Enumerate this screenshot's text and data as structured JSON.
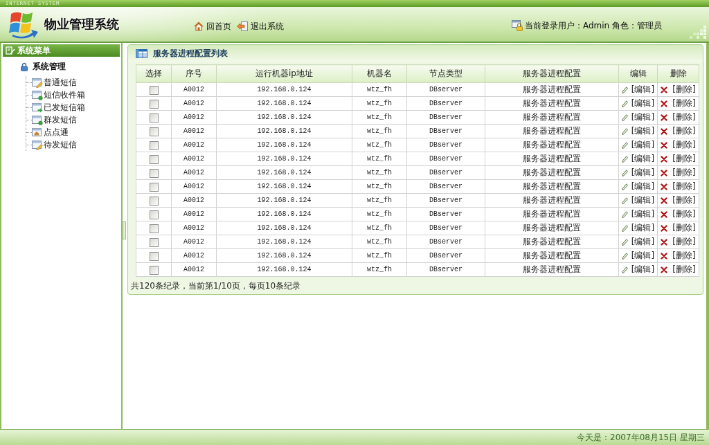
{
  "header": {
    "tagline": "INTERNET SYSTEM",
    "title": "物业管理系统",
    "nav": [
      {
        "label": "回首页",
        "kind": "home"
      },
      {
        "label": "退出系统",
        "kind": "logout"
      }
    ],
    "user_info": "当前登录用户：Admin 角色：管理员"
  },
  "sidebar": {
    "title": "系统菜单",
    "group": {
      "label": "系统管理",
      "children": [
        {
          "label": "普通短信",
          "kind": "compose"
        },
        {
          "label": "短信收件箱",
          "kind": "inbox"
        },
        {
          "label": "已发短信箱",
          "kind": "sent"
        },
        {
          "label": "群发短信",
          "kind": "broadcast"
        },
        {
          "label": "点点通",
          "kind": "web"
        },
        {
          "label": "待发短信",
          "kind": "draft"
        }
      ]
    }
  },
  "panel": {
    "title": "服务器进程配置列表",
    "table": {
      "columns": [
        "选择",
        "序号",
        "运行机器ip地址",
        "机器名",
        "节点类型",
        "服务器进程配置",
        "编辑",
        "删除"
      ],
      "rows": [
        {
          "checked": false,
          "id": "A0012",
          "ip": "192.168.0.124",
          "host": "wtz_fh",
          "node_type": "DBserver",
          "config": "服务器进程配置",
          "edit": "[编辑]",
          "delete": "[删除]"
        },
        {
          "checked": false,
          "id": "A0012",
          "ip": "192.168.0.124",
          "host": "wtz_fh",
          "node_type": "DBserver",
          "config": "服务器进程配置",
          "edit": "[编辑]",
          "delete": "[删除]"
        },
        {
          "checked": false,
          "id": "A0012",
          "ip": "192.168.0.124",
          "host": "wtz_fh",
          "node_type": "DBserver",
          "config": "服务器进程配置",
          "edit": "[编辑]",
          "delete": "[删除]"
        },
        {
          "checked": false,
          "id": "A0012",
          "ip": "192.168.0.124",
          "host": "wtz_fh",
          "node_type": "DBserver",
          "config": "服务器进程配置",
          "edit": "[编辑]",
          "delete": "[删除]"
        },
        {
          "checked": false,
          "id": "A0012",
          "ip": "192.168.0.124",
          "host": "wtz_fh",
          "node_type": "DBserver",
          "config": "服务器进程配置",
          "edit": "[编辑]",
          "delete": "[删除]"
        },
        {
          "checked": false,
          "id": "A0012",
          "ip": "192.168.0.124",
          "host": "wtz_fh",
          "node_type": "DBserver",
          "config": "服务器进程配置",
          "edit": "[编辑]",
          "delete": "[删除]"
        },
        {
          "checked": false,
          "id": "A0012",
          "ip": "192.168.0.124",
          "host": "wtz_fh",
          "node_type": "DBserver",
          "config": "服务器进程配置",
          "edit": "[编辑]",
          "delete": "[删除]"
        },
        {
          "checked": false,
          "id": "A0012",
          "ip": "192.168.0.124",
          "host": "wtz_fh",
          "node_type": "DBserver",
          "config": "服务器进程配置",
          "edit": "[编辑]",
          "delete": "[删除]"
        },
        {
          "checked": false,
          "id": "A0012",
          "ip": "192.168.0.124",
          "host": "wtz_fh",
          "node_type": "DBserver",
          "config": "服务器进程配置",
          "edit": "[编辑]",
          "delete": "[删除]"
        },
        {
          "checked": false,
          "id": "A0012",
          "ip": "192.168.0.124",
          "host": "wtz_fh",
          "node_type": "DBserver",
          "config": "服务器进程配置",
          "edit": "[编辑]",
          "delete": "[删除]"
        },
        {
          "checked": false,
          "id": "A0012",
          "ip": "192.168.0.124",
          "host": "wtz_fh",
          "node_type": "DBserver",
          "config": "服务器进程配置",
          "edit": "[编辑]",
          "delete": "[删除]"
        },
        {
          "checked": false,
          "id": "A0012",
          "ip": "192.168.0.124",
          "host": "wtz_fh",
          "node_type": "DBserver",
          "config": "服务器进程配置",
          "edit": "[编辑]",
          "delete": "[删除]"
        },
        {
          "checked": false,
          "id": "A0012",
          "ip": "192.168.0.124",
          "host": "wtz_fh",
          "node_type": "DBserver",
          "config": "服务器进程配置",
          "edit": "[编辑]",
          "delete": "[删除]"
        },
        {
          "checked": false,
          "id": "A0012",
          "ip": "192.168.0.124",
          "host": "wtz_fh",
          "node_type": "DBserver",
          "config": "服务器进程配置",
          "edit": "[编辑]",
          "delete": "[删除]"
        }
      ]
    },
    "pagination": "共120条纪录，当前第1/10页，每页10条纪录"
  },
  "status_bar": {
    "date": "今天是：2007年08月15日 星期三"
  }
}
